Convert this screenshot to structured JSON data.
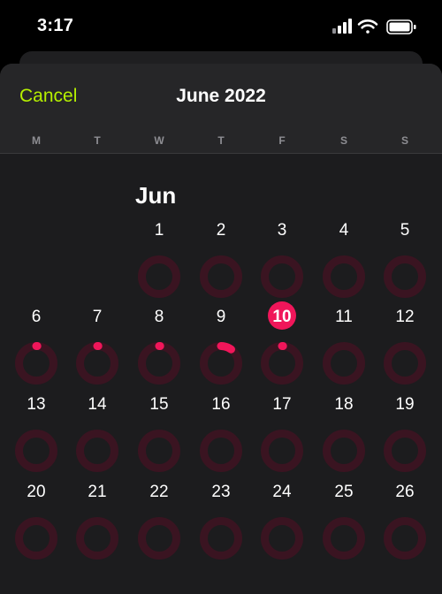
{
  "status": {
    "time": "3:17",
    "icons": [
      "cellular-signal-icon",
      "wifi-icon",
      "battery-icon"
    ]
  },
  "nav": {
    "cancel_label": "Cancel",
    "title": "June 2022"
  },
  "weekdays": [
    "M",
    "T",
    "W",
    "T",
    "F",
    "S",
    "S"
  ],
  "month": {
    "label": "Jun",
    "today": 10,
    "colors": {
      "accent": "#b6f000",
      "ring_track": "#3a1421",
      "ring_progress": "#f0165a",
      "today_fill": "#f0165a"
    },
    "days": [
      {
        "day": "1",
        "move_progress": 0
      },
      {
        "day": "2",
        "move_progress": 0
      },
      {
        "day": "3",
        "move_progress": 0
      },
      {
        "day": "4",
        "move_progress": 0
      },
      {
        "day": "5",
        "move_progress": 0
      },
      {
        "day": "6",
        "move_progress": 0.01
      },
      {
        "day": "7",
        "move_progress": 0.01
      },
      {
        "day": "8",
        "move_progress": 0.01
      },
      {
        "day": "9",
        "move_progress": 0.1
      },
      {
        "day": "10",
        "move_progress": 0.01
      },
      {
        "day": "11",
        "move_progress": 0
      },
      {
        "day": "12",
        "move_progress": 0
      },
      {
        "day": "13",
        "move_progress": 0
      },
      {
        "day": "14",
        "move_progress": 0
      },
      {
        "day": "15",
        "move_progress": 0
      },
      {
        "day": "16",
        "move_progress": 0
      },
      {
        "day": "17",
        "move_progress": 0
      },
      {
        "day": "18",
        "move_progress": 0
      },
      {
        "day": "19",
        "move_progress": 0
      },
      {
        "day": "20",
        "move_progress": 0
      },
      {
        "day": "21",
        "move_progress": 0
      },
      {
        "day": "22",
        "move_progress": 0
      },
      {
        "day": "23",
        "move_progress": 0
      },
      {
        "day": "24",
        "move_progress": 0
      },
      {
        "day": "25",
        "move_progress": 0
      },
      {
        "day": "26",
        "move_progress": 0
      }
    ]
  }
}
